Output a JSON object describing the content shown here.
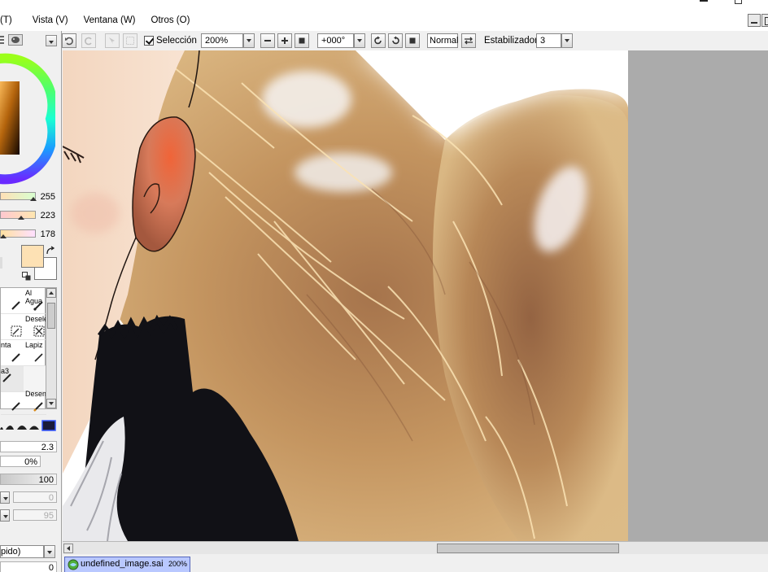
{
  "menu": {
    "items": [
      {
        "id": "image",
        "label": "(T)"
      },
      {
        "id": "view",
        "label": "Vista (V)"
      },
      {
        "id": "window",
        "label": "Ventana (W)"
      },
      {
        "id": "other",
        "label": "Otros (O)"
      }
    ]
  },
  "toolbar": {
    "selection_label": "Selección",
    "zoom_value": "200%",
    "rotation_value": "+000°",
    "blend_mode": "Normal",
    "stabilizer_label": "Estabilizador",
    "stabilizer_value": "3"
  },
  "color_panel": {
    "slider_values": [
      "255",
      "223",
      "178"
    ],
    "primary_color": "#fde1b4",
    "secondary_color": "#ffffff"
  },
  "tools": [
    {
      "id": "watercolor",
      "label": "Al Agua"
    },
    {
      "id": "deselect",
      "label": "Deselec."
    },
    {
      "id": "pen-partial",
      "label": "nta"
    },
    {
      "id": "pencil",
      "label": "Lapiz"
    },
    {
      "id": "brush3",
      "label": "a3"
    },
    {
      "id": "blur",
      "label": "Desenf."
    }
  ],
  "brush_settings": {
    "size": "2.3",
    "min_size": "0%",
    "density": "100",
    "value_a": "0",
    "value_b": "95",
    "mode_partial": "pido)",
    "bottom_value": "0"
  },
  "document": {
    "filename": "undefined_image.sai",
    "zoom": "200%"
  }
}
